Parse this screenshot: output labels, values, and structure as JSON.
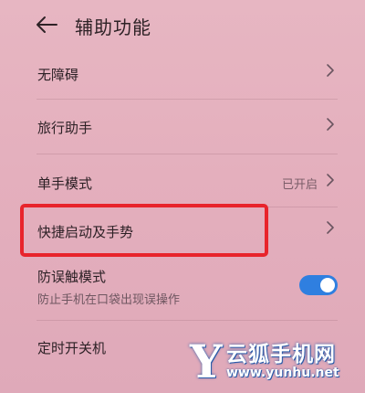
{
  "header": {
    "title": "辅助功能",
    "back_icon": "arrow-left-icon"
  },
  "items": [
    {
      "label": "无障碍"
    },
    {
      "label": "旅行助手"
    },
    {
      "label": "单手模式",
      "status": "已开启"
    },
    {
      "label": "快捷启动及手势"
    },
    {
      "label": "防误触模式",
      "sublabel": "防止手机在口袋出现误操作",
      "toggle_on": true
    },
    {
      "label": "定时开关机"
    }
  ],
  "colors": {
    "toggle_accent": "#2f7fe0",
    "highlight_border": "#e8242c"
  },
  "watermark": {
    "logo_letter": "Y",
    "name": "云狐手机网",
    "url": "www.yunhu.net"
  }
}
